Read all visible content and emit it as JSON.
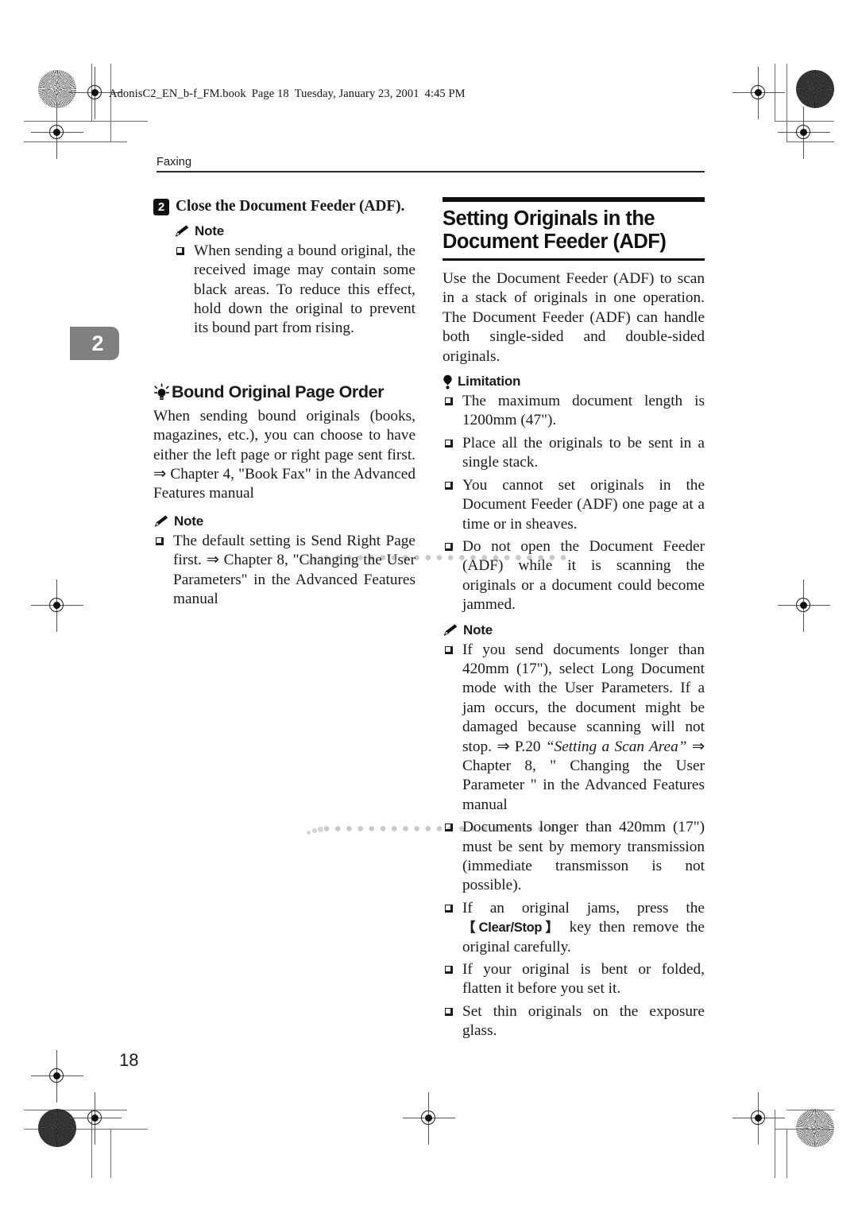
{
  "file_banner": {
    "filename": "AdonisC2_EN_b-f_FM.book",
    "page": "Page 18",
    "weekday": "Tuesday, January 23, 2001",
    "time": "4:45 PM"
  },
  "running_head": {
    "label": "Faxing"
  },
  "chapter_tab": {
    "number": "2"
  },
  "page_number": "18",
  "left_column": {
    "step": {
      "number": "2",
      "text": "Close the Document Feeder (ADF)."
    },
    "note_label": "Note",
    "note_items": [
      "When sending a bound original, the received image may contain some black areas. To reduce this effect, hold down the original to prevent its bound part from rising."
    ],
    "tip": {
      "icon": "lightbulb-icon",
      "title": "Bound Original Page Order",
      "body": "When sending bound originals (books, magazines, etc.), you can choose to have either the left page or right page sent first. ⇒ Chapter 4, \"Book Fax\" in the Advanced Features manual"
    },
    "note2_label": "Note",
    "note2_items": [
      "The default setting is Send Right Page first. ⇒ Chapter 8, \"Changing the User Parameters\" in the Advanced Features manual"
    ]
  },
  "right_column": {
    "section_title_line1": "Setting Originals in the",
    "section_title_line2": "Document Feeder (ADF)",
    "intro": "Use the Document Feeder (ADF) to scan in a stack of originals in one operation. The Document Feeder (ADF) can handle both single-sided and double-sided originals.",
    "limitation_label": "Limitation",
    "limitation_items": [
      "The maximum document length is 1200mm (47\").",
      "Place all the originals to be sent in a single stack.",
      "You cannot set originals in the Document Feeder (ADF) one page at a time or in sheaves.",
      "Do not open the Document Feeder (ADF) while it is scanning the originals or a document could become jammed."
    ],
    "note_label": "Note",
    "note_item_1_part1": "If you send documents longer than 420mm (17\"), select Long Document mode with the User Parameters. If a jam occurs, the document might be damaged because scanning will not stop. ⇒ P.20 ",
    "note_item_1_italic": "“Setting a Scan Area”",
    "note_item_1_part2": " ⇒ Chapter 8, \" Changing the User Parameter \" in the Advanced Features manual",
    "note_item_2": "Documents longer than 420mm (17\") must be sent by memory transmission (immediate transmisson is not possible).",
    "note_item_3_part1": "If an original jams, press the ",
    "note_item_3_key": "【Clear/Stop】",
    "note_item_3_part2": " key then remove the original carefully.",
    "note_item_4": "If your original is bent or folded, flatten it before you set it.",
    "note_item_5": "Set thin originals on the exposure glass."
  },
  "colors": {
    "ink": "#1a1a1a",
    "tab_gray": "#808080",
    "dot_gray": "#c9c9c9"
  }
}
